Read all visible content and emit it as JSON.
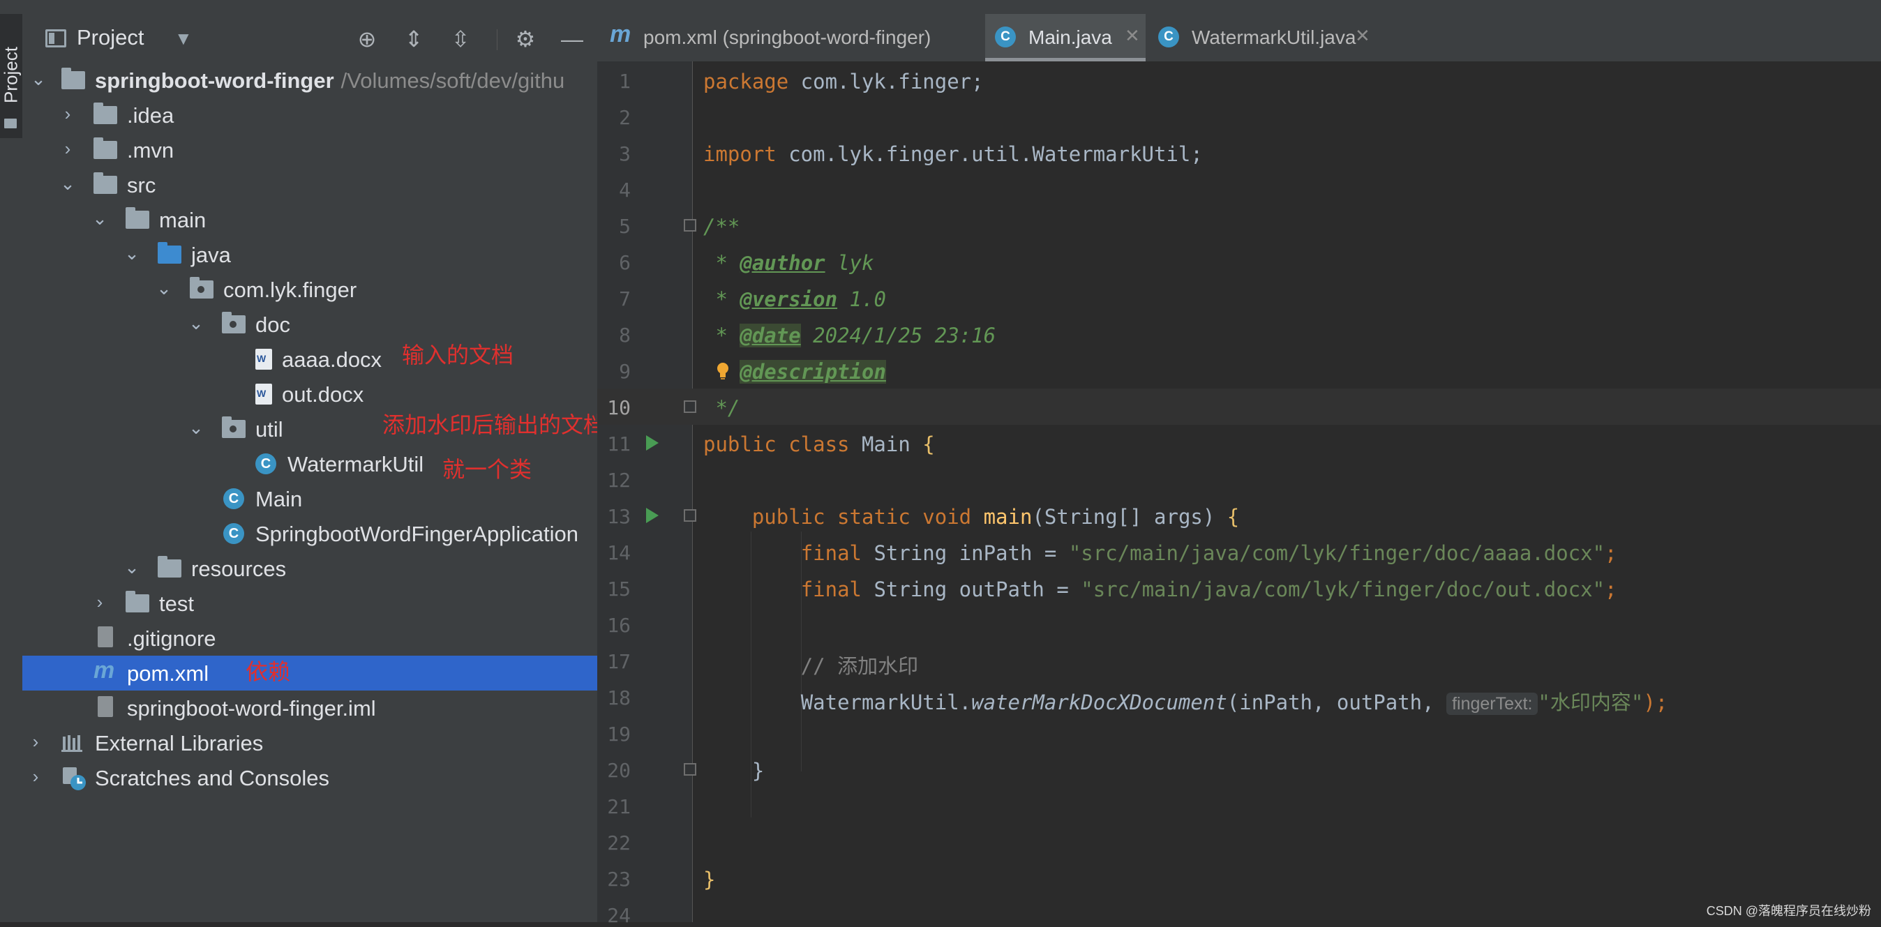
{
  "sidebar_tab": {
    "label": "Project"
  },
  "project_panel": {
    "title": "Project",
    "tree": [
      {
        "label": "springboot-word-finger",
        "path": "/Volumes/soft/dev/githu",
        "expanded": true
      },
      {
        "label": ".idea",
        "expanded": false
      },
      {
        "label": ".mvn",
        "expanded": false
      },
      {
        "label": "src",
        "expanded": true
      },
      {
        "label": "main",
        "expanded": true
      },
      {
        "label": "java",
        "expanded": true
      },
      {
        "label": "com.lyk.finger",
        "expanded": true
      },
      {
        "label": "doc",
        "expanded": true
      },
      {
        "label": "aaaa.docx"
      },
      {
        "label": "out.docx"
      },
      {
        "label": "util",
        "expanded": true
      },
      {
        "label": "WatermarkUtil"
      },
      {
        "label": "Main"
      },
      {
        "label": "SpringbootWordFingerApplication"
      },
      {
        "label": "resources",
        "expanded": true
      },
      {
        "label": "test",
        "expanded": false
      },
      {
        "label": ".gitignore"
      },
      {
        "label": "pom.xml",
        "selected": true
      },
      {
        "label": "springboot-word-finger.iml"
      },
      {
        "label": "External Libraries",
        "expanded": false
      },
      {
        "label": "Scratches and Consoles",
        "expanded": false
      }
    ],
    "annotations": {
      "input_doc": "输入的文档",
      "output_doc": "添加水印后输出的文档",
      "one_class": "就一个类",
      "dependency": "依赖"
    }
  },
  "editor": {
    "tabs": [
      {
        "label": "pom.xml (springboot-word-finger)",
        "active": false
      },
      {
        "label": "Main.java",
        "active": true
      },
      {
        "label": "WatermarkUtil.java",
        "active": false
      }
    ],
    "line_numbers": [
      "1",
      "2",
      "3",
      "4",
      "5",
      "6",
      "7",
      "8",
      "9",
      "10",
      "11",
      "12",
      "13",
      "14",
      "15",
      "16",
      "17",
      "18",
      "19",
      "20",
      "21",
      "22",
      "23",
      "24"
    ],
    "code": {
      "l1_kw": "package",
      "l1_rest": " com.lyk.finger;",
      "l3_kw": "import",
      "l3_rest": " com.lyk.finger.util.WatermarkUtil;",
      "l5": "/**",
      "l6_pre": " * ",
      "l6_tag": "@author",
      "l6_val": " lyk",
      "l7_pre": " * ",
      "l7_tag": "@version",
      "l7_val": " 1.0",
      "l8_pre": " * ",
      "l8_tag": "@date",
      "l8_val": " 2024/1/25 23:16",
      "l9_tag": "@description",
      "l10": " */",
      "l11_kw": "public class",
      "l11_name": " Main ",
      "l11_brace": "{",
      "l13_kw": "public static void",
      "l13_fn": " main",
      "l13_args": "(String[] args) ",
      "l13_brace": "{",
      "l14_kw": "final",
      "l14_mid": " String inPath = ",
      "l14_str": "\"src/main/java/com/lyk/finger/doc/aaaa.docx\"",
      "l14_end": ";",
      "l15_kw": "final",
      "l15_mid": " String outPath = ",
      "l15_str": "\"src/main/java/com/lyk/finger/doc/out.docx\"",
      "l15_end": ";",
      "l17": "// 添加水印",
      "l18_cls": "WatermarkUtil.",
      "l18_fn": "waterMarkDocXDocument",
      "l18_args": "(inPath, outPath, ",
      "l18_hint": "fingerText:",
      "l18_str": "\"水印内容\"",
      "l18_end": ");",
      "l20": "}",
      "l23": "}"
    }
  },
  "watermark": "CSDN @落魄程序员在线炒粉"
}
